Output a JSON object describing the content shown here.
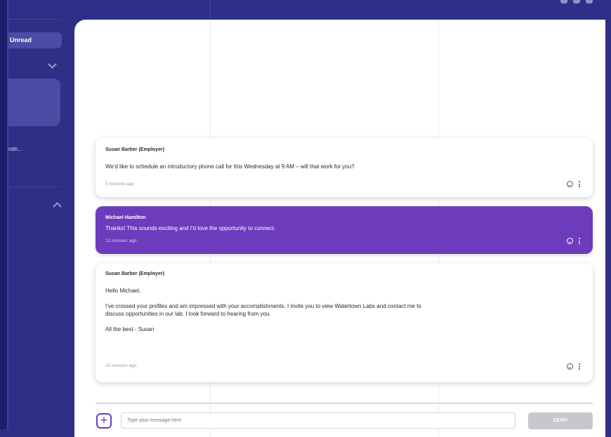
{
  "sidebar": {
    "unread_label": "Unread",
    "convo_snippet": "ndn..."
  },
  "messages": [
    {
      "sender": "Susan Barber (Employer)",
      "body": "We'd like to schedule an introductory phone call for this Wednesday at 9 AM – will that work for you?",
      "time": "5 minutes ago",
      "direction": "incoming"
    },
    {
      "sender": "Michael Hamilton",
      "body": "Thanks!  This sounds exciting and I'd love the opportunity to connect.",
      "time": "12 minutes ago",
      "direction": "outgoing"
    },
    {
      "sender": "Susan Barber (Employer)",
      "body": "Hello Michael,\n\nI've crossed your profiles and am impressed with your accomplishments. I invite you to view Watertown Labs and contact me to discuss opportunities in our lab. I look forward to hearing from you.\n\nAll the best - Susan",
      "time": "25 minutes ago",
      "direction": "incoming"
    }
  ],
  "composer": {
    "add_symbol": "+",
    "placeholder": "Type your message here",
    "send_label": "SEND"
  },
  "colors": {
    "brand": "#2f2f86",
    "accent": "#6c3cbd"
  },
  "icons": [
    "plus-icon",
    "emoji-icon",
    "more-icon",
    "chevron-down-icon",
    "chevron-up-icon"
  ]
}
